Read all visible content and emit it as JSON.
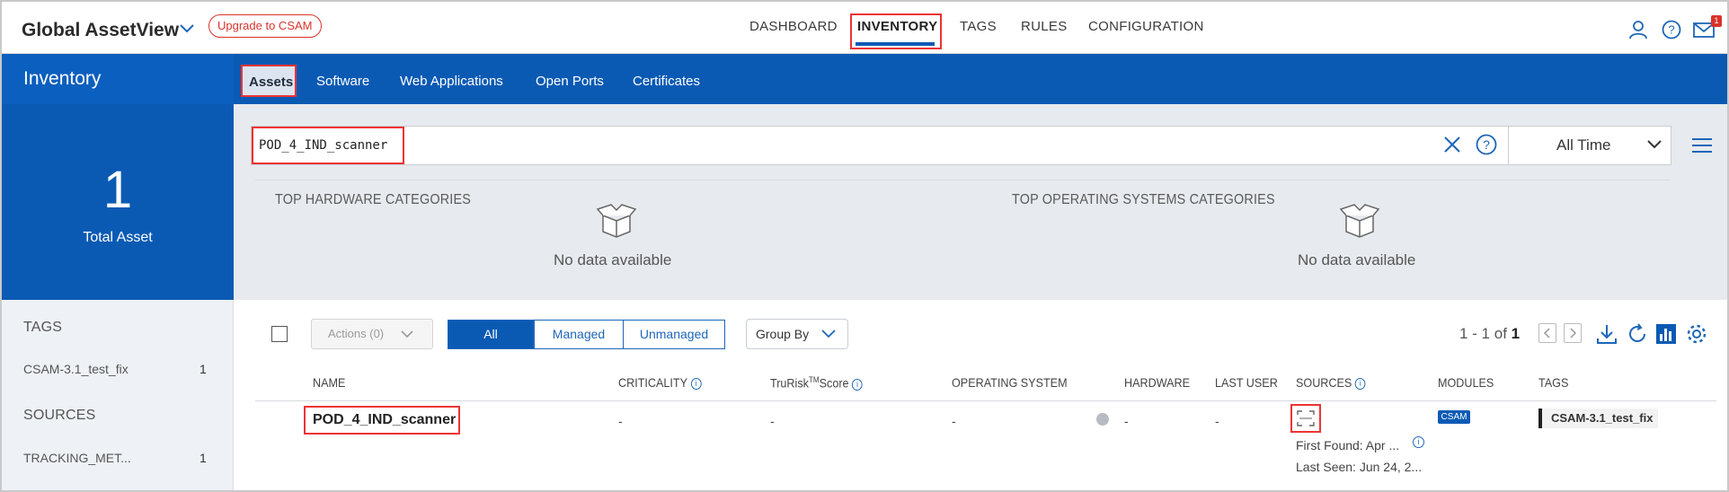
{
  "header": {
    "app_title": "Global AssetView",
    "upgrade_label": "Upgrade to CSAM",
    "nav": [
      "DASHBOARD",
      "INVENTORY",
      "TAGS",
      "RULES",
      "CONFIGURATION"
    ],
    "active_nav": "INVENTORY",
    "mail_badge": "1"
  },
  "section": {
    "title": "Inventory",
    "subtabs": [
      "Assets",
      "Software",
      "Web Applications",
      "Open Ports",
      "Certificates"
    ],
    "active_subtab": "Assets"
  },
  "summary": {
    "total_count": "1",
    "total_label": "Total Asset"
  },
  "sidebar": {
    "tags_heading": "TAGS",
    "tags": [
      {
        "label": "CSAM-3.1_test_fix",
        "count": "1"
      }
    ],
    "sources_heading": "SOURCES",
    "sources": [
      {
        "label": "TRACKING_MET...",
        "count": "1"
      }
    ]
  },
  "search": {
    "query": "POD_4_IND_scanner",
    "time_filter": "All Time"
  },
  "categories": {
    "hardware_heading": "TOP HARDWARE CATEGORIES",
    "os_heading": "TOP OPERATING SYSTEMS CATEGORIES",
    "no_data": "No data available"
  },
  "toolbar": {
    "actions_label": "Actions (0)",
    "filters": [
      "All",
      "Managed",
      "Unmanaged"
    ],
    "active_filter": "All",
    "group_by_label": "Group By",
    "paging_range": "1 - 1 of",
    "paging_total": "1"
  },
  "table": {
    "columns": {
      "name": "NAME",
      "criticality": "CRITICALITY",
      "trurisk_prefix": "TruRisk",
      "trurisk_sup": "TM",
      "trurisk_suffix": "Score",
      "os": "OPERATING SYSTEM",
      "hardware": "HARDWARE",
      "last_user": "LAST USER",
      "sources": "SOURCES",
      "modules": "MODULES",
      "tags": "TAGS"
    },
    "rows": [
      {
        "name": "POD_4_IND_scanner",
        "criticality": "-",
        "trurisk": "-",
        "os": "-",
        "hardware": "-",
        "last_user": "-",
        "first_found": "First Found: Apr ...",
        "last_seen": "Last Seen: Jun 24, 2...",
        "module": "CSAM",
        "tag": "CSAM-3.1_test_fix"
      }
    ]
  },
  "colors": {
    "brand_blue": "#0a5ab4",
    "highlight_red": "#ee3333"
  }
}
